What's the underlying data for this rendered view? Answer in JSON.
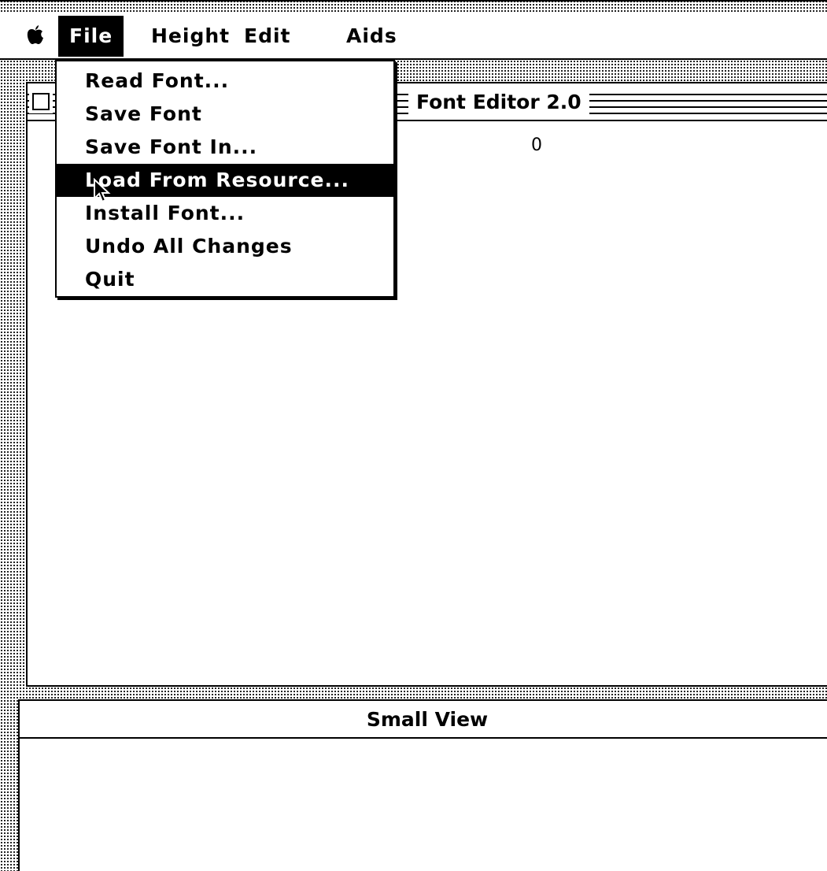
{
  "menubar": {
    "apple_icon": "apple-logo-icon",
    "menus": [
      {
        "label": "File",
        "active": true
      },
      {
        "label": "Height"
      },
      {
        "label": "Edit"
      },
      {
        "label": "Aids"
      }
    ]
  },
  "file_menu": {
    "items": [
      {
        "label": "Read Font..."
      },
      {
        "label": "Save Font"
      },
      {
        "label": "Save Font In..."
      },
      {
        "label": "Load From Resource...",
        "selected": true
      },
      {
        "label": "Install Font..."
      },
      {
        "label": "Undo All Changes"
      },
      {
        "label": "Quit"
      }
    ]
  },
  "main_window": {
    "title": "Font Editor 2.0",
    "content_text": "0"
  },
  "small_view_window": {
    "title": "Small View"
  },
  "colors": {
    "foreground": "#000000",
    "background": "#ffffff"
  }
}
